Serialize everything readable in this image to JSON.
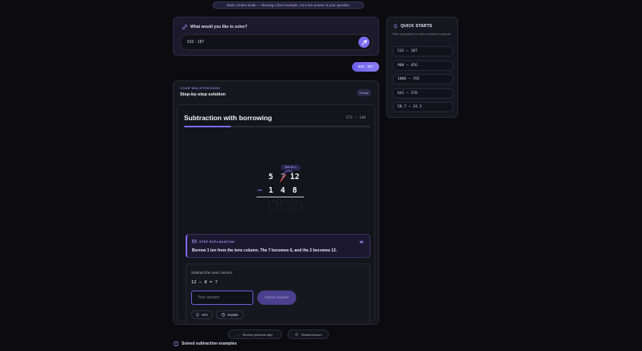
{
  "banner": "Static content mode — showing a fixed example, not a live answer to your question.",
  "ask": {
    "title": "What would you like to solve?",
    "value": "532 - 187"
  },
  "user_bubble": "532 - 187",
  "quick_starts": {
    "title": "QUICK STARTS",
    "subtitle": "Pick a question to see a worked example.",
    "items": [
      "532 − 187",
      "900 − 456",
      "1000 − 765",
      "641 − 278",
      "58.7 − 24.3"
    ]
  },
  "walkthrough": {
    "label": "YOUR WALKTHROUGH",
    "title": "Step-by-step solution",
    "status": "Ready",
    "lesson": {
      "title": "Subtraction with borrowing",
      "problem": "572 − 148",
      "progress": 0.25,
      "borrow_tag": "Borrow 1",
      "top_digits": [
        "5",
        "7",
        "12"
      ],
      "bottom_digits": [
        "−",
        "1",
        "4",
        "8"
      ]
    },
    "explanation": {
      "label": "STEP EXPLANATION",
      "text": "Borrow 1 ten from the tens column. The 7 becomes 6, and the 2 becomes 12."
    },
    "practice": {
      "question": "Subtract the ones column.",
      "equation": "12 − 8 = ?",
      "placeholder": "Your answer",
      "check": "Check Answer",
      "hint": "Hint",
      "explain": "Explain"
    },
    "review": "Review previous step",
    "restart": "Restart lesson"
  },
  "solved_heading": "Solved subtraction examples",
  "colors": {
    "accent": "#7b6cf0",
    "background": "#0c0c10",
    "card": "#17171f"
  }
}
